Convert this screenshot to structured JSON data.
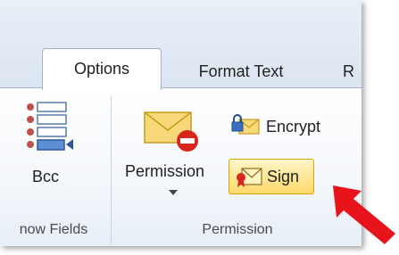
{
  "tabs": {
    "options": "Options",
    "format_text": "Format Text",
    "review_partial": "R"
  },
  "show_fields_group": {
    "bcc_label": "Bcc",
    "group_label": "now Fields"
  },
  "permission_group": {
    "permission_label": "Permission",
    "encrypt_label": "Encrypt",
    "sign_label": "Sign",
    "group_label": "Permission"
  },
  "colors": {
    "accent_arrow": "#e8141b",
    "sign_highlight": "#ffd96b",
    "ribbon_border": "#9fb3cc"
  },
  "icons": [
    "bcc-fields-icon",
    "permission-envelope-icon",
    "encrypt-lock-icon",
    "sign-certificate-icon",
    "dropdown-arrow-icon",
    "pointer-arrow"
  ]
}
